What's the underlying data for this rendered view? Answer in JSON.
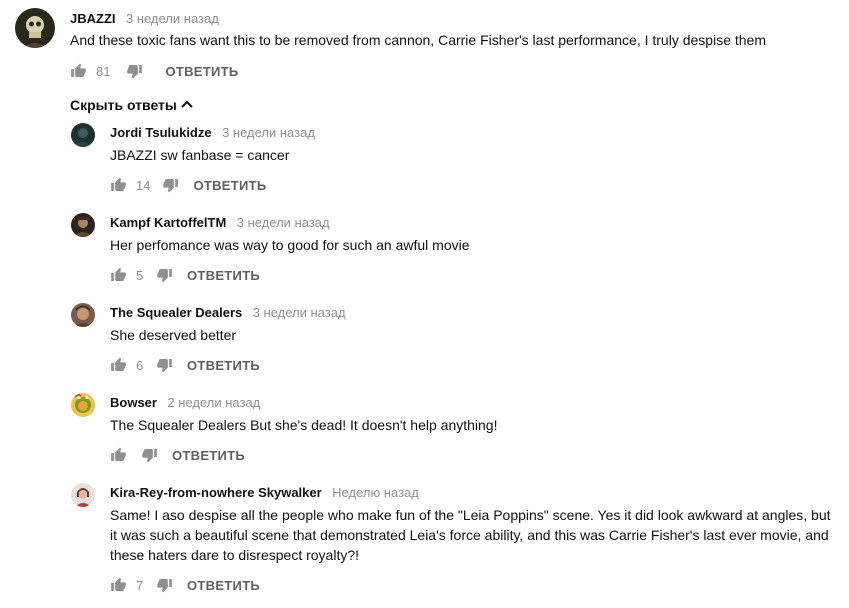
{
  "top_comment": {
    "author": "JBAZZI",
    "time": "3 недели назад",
    "text": "And these toxic fans want this to be removed from cannon, Carrie Fisher's last performance, I truly despise them",
    "likes": "81",
    "reply_label": "ОТВЕТИТЬ"
  },
  "replies_toggle": {
    "label": "Скрыть ответы"
  },
  "replies": [
    {
      "author": "Jordi Tsulukidze",
      "time": "3 недели назад",
      "text": "JBAZZI sw fanbase = cancer",
      "likes": "14",
      "reply_label": "ОТВЕТИТЬ"
    },
    {
      "author": "Kampf KartoffelTM",
      "time": "3 недели назад",
      "text": "Her perfomance was way to good for such an awful movie",
      "likes": "5",
      "reply_label": "ОТВЕТИТЬ"
    },
    {
      "author": "The Squealer Dealers",
      "time": "3 недели назад",
      "text": "She deserved better",
      "likes": "6",
      "reply_label": "ОТВЕТИТЬ"
    },
    {
      "author": "Bowser",
      "time": "2 недели назад",
      "text": "The Squealer Dealers But she's dead! It doesn't help anything!",
      "likes": "",
      "reply_label": "ОТВЕТИТЬ"
    },
    {
      "author": "Kira-Rey-from-nowhere Skywalker",
      "time": "Неделю назад",
      "text_lines": [
        "Same! I aso despise all the people who make fun of the \"Leia Poppins\" scene. Yes it did look awkward at angles, but",
        "it was such a beautiful scene that demonstrated Leia's force ability, and this was Carrie Fisher's last ever movie, and",
        "these haters dare to disrespect royalty?!"
      ],
      "likes": "7",
      "reply_label": "ОТВЕТИТЬ"
    }
  ],
  "colors": {
    "icon": "#909090",
    "secondary_text": "#909090",
    "reply_text": "#606060"
  }
}
